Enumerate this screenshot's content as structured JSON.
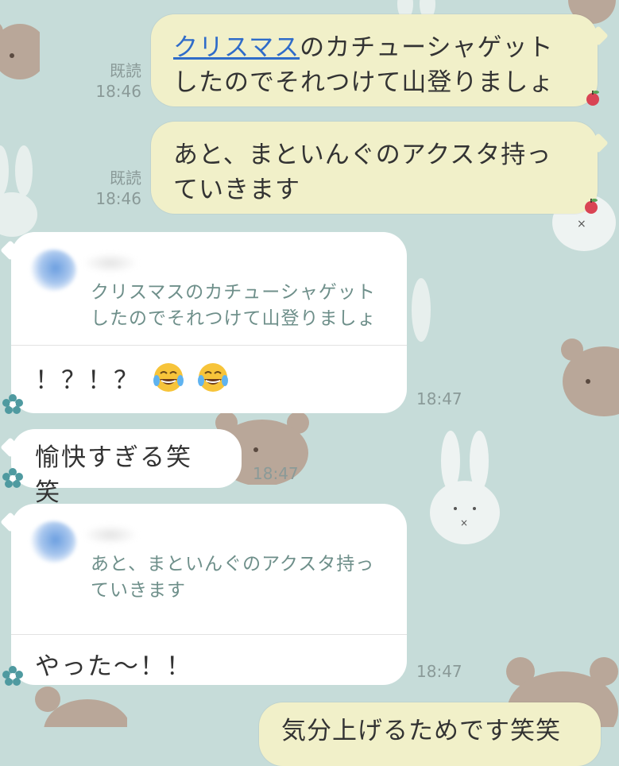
{
  "messages": [
    {
      "read_label": "既読",
      "time": "18:46",
      "link_text": "クリスマス",
      "line1_rest": "のカチューシャゲット",
      "line2": "したのでそれつけて山登りましょ"
    },
    {
      "read_label": "既読",
      "time": "18:46",
      "line1": "あと、まといんぐのアクスタ持っ",
      "line2": "ていきます"
    },
    {
      "quote_line1": "クリスマスのカチューシャゲット",
      "quote_line2": "したのでそれつけて山登りましょ",
      "text": "！？！？",
      "emoji": "face-with-tears-of-joy",
      "time": "18:47"
    },
    {
      "text": "愉快すぎる笑笑",
      "time": "18:47"
    },
    {
      "quote_line1": "あと、まといんぐのアクスタ持っ",
      "quote_line2": "ていきます",
      "text": "やった〜！！",
      "time": "18:47"
    },
    {
      "text_partial": "気分上げるためです笑笑"
    }
  ],
  "colors": {
    "background": "#c6dcd9",
    "outgoing_bubble": "#f1f0c9",
    "incoming_bubble": "#ffffff",
    "link": "#2f6cc9",
    "quote_text": "#6e8f8a"
  }
}
